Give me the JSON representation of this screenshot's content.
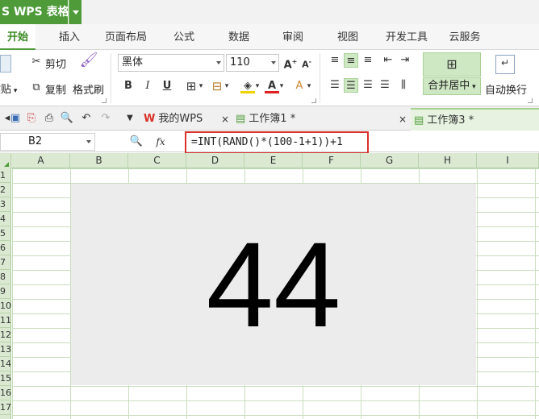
{
  "titlebar": {
    "app_label": "S WPS 表格"
  },
  "menu": [
    "开始",
    "插入",
    "页面布局",
    "公式",
    "数据",
    "审阅",
    "视图",
    "开发工具",
    "云服务"
  ],
  "ribbon": {
    "paste_label": "粘贴",
    "cut_label": "剪切",
    "copy_label": "复制",
    "format_painter_label": "格式刷",
    "font_name": "黑体",
    "font_size": "110",
    "merge_center_label": "合并居中",
    "wrap_text_label": "自动换行"
  },
  "tabs": [
    {
      "label": "我的WPS",
      "icon": "wps-logo-icon"
    },
    {
      "label": "工作簿1 *",
      "icon": "sheet-file-icon"
    },
    {
      "label": "工作簿3 *",
      "icon": "sheet-file-icon"
    }
  ],
  "formula_bar": {
    "cell_ref": "B2",
    "fx_label": "fx",
    "formula": "=INT(RAND()*(100-1+1))+1"
  },
  "columns": [
    "A",
    "B",
    "C",
    "D",
    "E",
    "F",
    "G",
    "H",
    "I"
  ],
  "rows": [
    "1",
    "2",
    "3",
    "4",
    "5",
    "6",
    "7",
    "8",
    "9",
    "10",
    "11",
    "12",
    "13",
    "14",
    "15",
    "16",
    "17"
  ],
  "cell_value": "44",
  "colors": {
    "brand_green": "#4f9b3a",
    "highlight_red": "#d9322b",
    "grid_line": "#c9ddbe"
  }
}
